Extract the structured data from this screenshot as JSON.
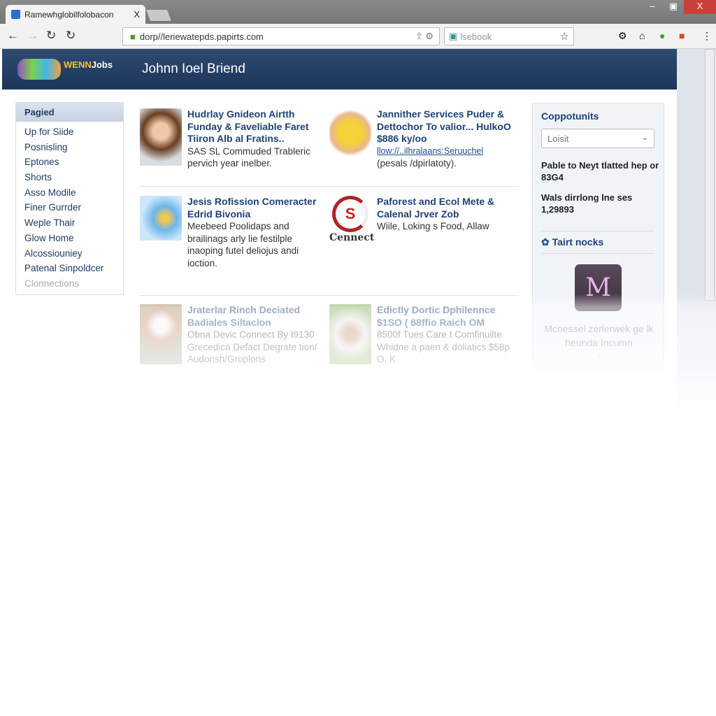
{
  "browser": {
    "tab_title": "Ramewhglobilfolobacon",
    "tab_close": "X",
    "url": "dorp//leriewatepds.papirts.com",
    "search_placeholder": "lsebook",
    "win": {
      "min": "–",
      "max": "▣",
      "close": "X"
    }
  },
  "header": {
    "logo_text_a": "WENN",
    "logo_text_b": "Jobs",
    "title": "Johnn Ioel Briend"
  },
  "sidebar": {
    "heading": "Pagied",
    "items": [
      "Up for Siide",
      "Posnisling",
      "Eptones",
      "Shorts",
      "Asso Modile",
      "Finer Gurrder",
      "Weple Thair",
      "Glow Home",
      "Alcossiouniey",
      "Patenal Sinpoldcer",
      "Clonnections"
    ]
  },
  "cards": [
    {
      "title": "Hudrlay Gnideon Airtth Funday & Faveliable Faret Tiiron Alb al Fratins..",
      "desc": "SAS SL Commuded Trableric pervich year inelber."
    },
    {
      "title": "Jannither Services Puder & Dettochor To valior... HulkoO $886 ky/oo",
      "link": "llow://..ilhralaans:Seruuchel",
      "desc": "(pesals /dpirlatoty)."
    },
    {
      "title": "Jesis Rofission Comeracter Edrid Bivonia",
      "desc": "Meebeed Poolidaps and brailinags arly lie festilple inaoping futel deliojus andi ioction."
    },
    {
      "title": "Paforest and Ecol Mete & Calenal Jrver Zob",
      "desc": "Wiile, Loking s Food, Allaw",
      "logo_text": "Cennect"
    },
    {
      "title": "Jraterlar Rinch Deciated Badiales Siltacion",
      "desc": "Obna Devic Connect By I9130 Grecedica Defact Degrate tion/ Audonsh/Groplons"
    },
    {
      "title": "Edictly Dortic Dphilennce $1SO ( 68ffio Raich OM",
      "desc": "8500f Tues Care t Comfinuilte Whidne a paen & doliatics $58p O. K"
    }
  ],
  "right_panel": {
    "heading": "Coppotunits",
    "select_value": "Loisit",
    "text1": "Pable to Neyt tlatted hep or 83G4",
    "text2": "Wals dirrlong lne ses 1,29893",
    "link": "Tairt nocks",
    "app_letter": "M",
    "caption": "Mcnessel zerlerwek ge lk heunda Incumn",
    "caption_arrow": "↓"
  },
  "colors": {
    "header": "#1d3558",
    "accent": "#1d4177"
  }
}
